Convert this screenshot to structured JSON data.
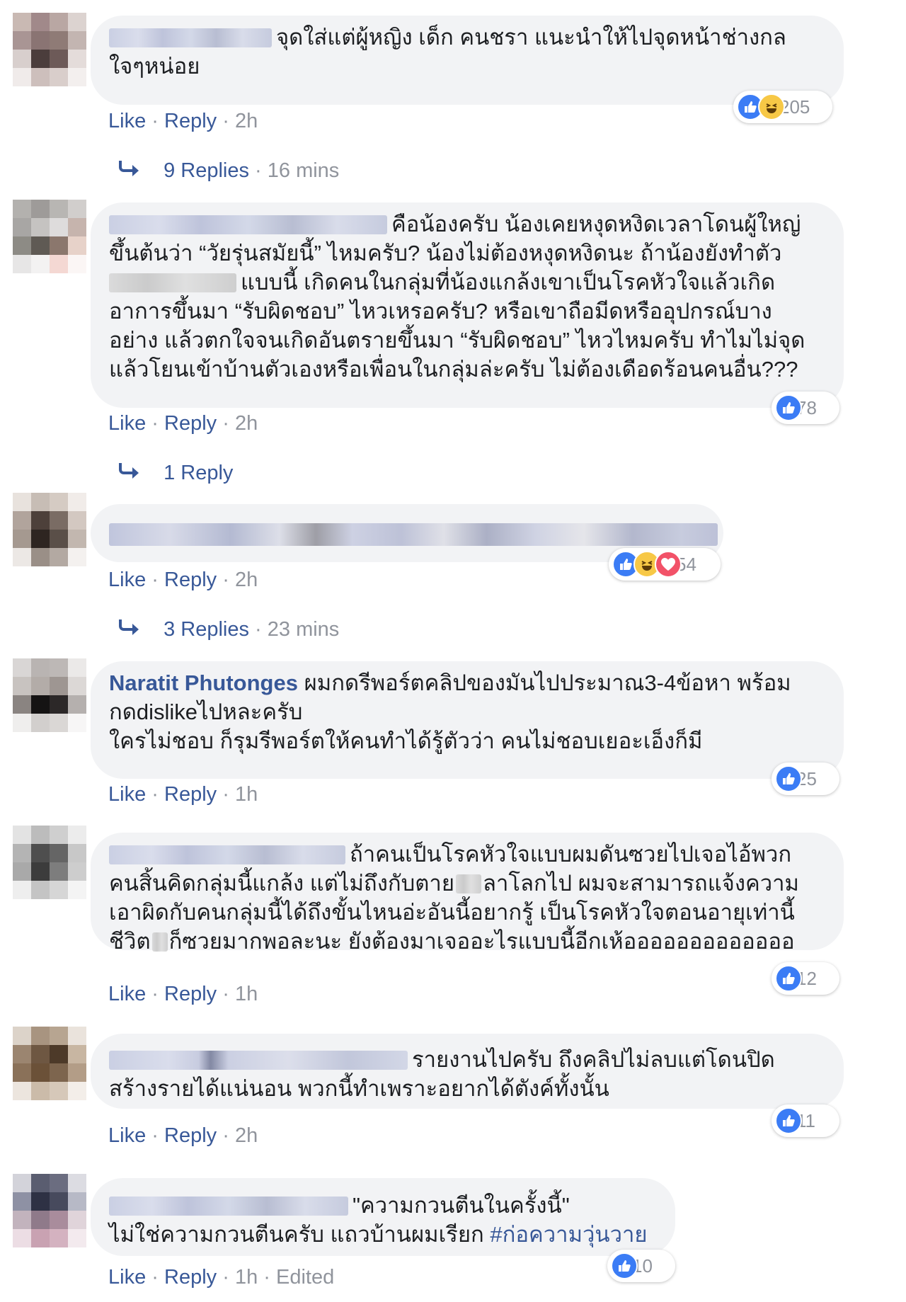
{
  "like_label": "Like",
  "reply_label": "Reply",
  "sep": "·",
  "comments": [
    {
      "lines": [
        "จุดใส่แต่ผู้หญิง เด็ก คนชรา แนะนำให้ไปจุดหน้าช่างกล",
        "ใจๆหน่อย"
      ],
      "time": "2h",
      "reactions": "205",
      "replies_text": "9 Replies",
      "replies_time": "16 mins"
    },
    {
      "lines": [
        "คือน้องครับ น้องเคยหงุดหงิดเวลาโดนผู้ใหญ่",
        "ขึ้นต้นว่า “วัยรุ่นสมัยนี้” ไหมครับ? น้องไม่ต้องหงุดหงิดนะ ถ้าน้องยังทำตัว",
        "แบบนี้ เกิดคนในกลุ่มที่น้องแกล้งเขาเป็นโรคหัวใจแล้วเกิด",
        "อาการขึ้นมา “รับผิดชอบ” ไหวเหรอครับ? หรือเขาถือมีดหรืออุปกรณ์บาง",
        "อย่าง แล้วตกใจจนเกิดอันตรายขึ้นมา “รับผิดชอบ” ไหวไหมครับ ทำไมไม่จุด",
        "แล้วโยนเข้าบ้านตัวเองหรือเพื่อนในกลุ่มล่ะครับ ไม่ต้องเดือดร้อนคนอื่น???"
      ],
      "time": "2h",
      "reactions": "78",
      "replies_text": "1 Reply",
      "replies_time": ""
    },
    {
      "lines": [],
      "time": "2h",
      "reactions": "54",
      "replies_text": "3 Replies",
      "replies_time": "23 mins"
    },
    {
      "author": "Naratit Phutonges",
      "lines": [
        "ผมกดรีพอร์ตคลิปของมันไปประมาณ3-4ข้อหา พร้อม",
        "กดdislikeไปหละครับ",
        "ใครไม่ชอบ ก็รุมรีพอร์ตให้คนทำได้รู้ตัวว่า คนไม่ชอบเยอะเอ็งก็มี"
      ],
      "time": "1h",
      "reactions": "25"
    },
    {
      "lines": [
        "ถ้าคนเป็นโรคหัวใจแบบผมดันซวยไปเจอไอ้พวก",
        "คนสิ้นคิดกลุ่มนี้แกล้ง แต่ไม่ถึงกับตาย",
        "ลาโลกไป ผมจะสามารถแจ้งความ",
        "เอาผิดกับคนกลุ่มนี้ได้ถึงขั้นไหนอ่ะอันนี้อยากรู้ เป็นโรคหัวใจตอนอายุเท่านี้",
        "ชีวิต",
        "ก็ซวยมากพอละนะ ยังต้องมาเจออะไรแบบนี้อีกเห้อออออออออออออ"
      ],
      "time": "1h",
      "reactions": "12"
    },
    {
      "lines": [
        "รายงานไปครับ ถึงคลิปไม่ลบแต่โดนปิด",
        "สร้างรายได้แน่นอน พวกนี้ทำเพราะอยากได้ตังค์ทั้งนั้น"
      ],
      "time": "2h",
      "reactions": "11"
    },
    {
      "lines": [
        "\"ความกวนตีนในครั้งนี้\"",
        "ไม่ใช่ความกวนตีนครับ แถวบ้านผมเรียก "
      ],
      "hashtag": "#ก่อความวุ่นวาย",
      "time": "1h",
      "edited": "Edited",
      "reactions": "10"
    }
  ],
  "icons": {
    "like": "like-reaction-icon",
    "haha": "haha-reaction-icon",
    "love": "love-reaction-icon",
    "reply_arrow": "reply-arrow-icon"
  },
  "colors": {
    "link": "#385898",
    "meta": "#90949c",
    "bubble": "#f2f3f5",
    "like": "#3b7cf5",
    "haha": "#f7c846",
    "love": "#f25268"
  }
}
